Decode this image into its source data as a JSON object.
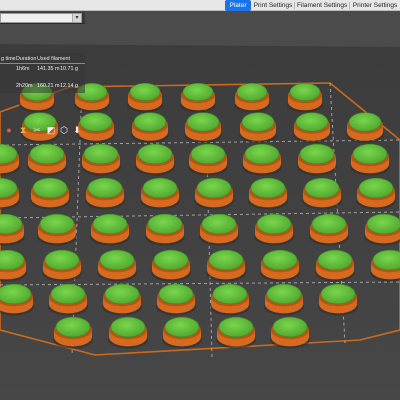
{
  "tabs": [
    {
      "label": "Plater",
      "active": true
    },
    {
      "label": "Print Settings",
      "active": false
    },
    {
      "label": "Filament Settings",
      "active": false
    },
    {
      "label": "Printer Settings",
      "active": false
    }
  ],
  "info_table": {
    "headers": [
      "g time",
      "Duration",
      "Used filament"
    ],
    "rows": [
      [
        "1h6m",
        "141.35 m",
        "10.71 g"
      ],
      [
        "2h20m",
        "160.21 m",
        "12.14 g"
      ]
    ]
  },
  "toolbar": {
    "icons": [
      "color-icon",
      "mirror-icon",
      "cut-icon",
      "scale-icon",
      "view-icon",
      "export-icon"
    ]
  },
  "colors": {
    "bed": "#3f3f3f",
    "part_top": "#5fbf3a",
    "part_side": "#d76a1e",
    "bed_border": "#cc6a1c",
    "grid": "#c9c9c9",
    "background": "#4b4b4b",
    "active_tab": "#1a73e8"
  }
}
